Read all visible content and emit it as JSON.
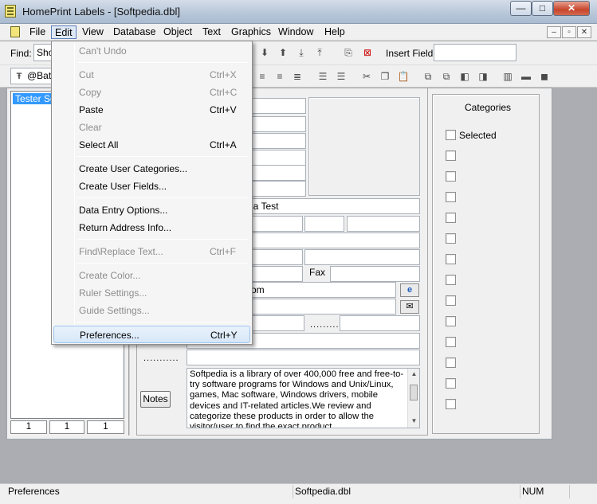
{
  "window": {
    "title": "HomePrint Labels - [Softpedia.dbl]",
    "min": "—",
    "max": "□",
    "close": "✕"
  },
  "menubar": [
    "File",
    "Edit",
    "View",
    "Database",
    "Object",
    "Text",
    "Graphics",
    "Window",
    "Help"
  ],
  "mdi_controls": [
    "–",
    "▫",
    "✕"
  ],
  "toolbar": {
    "find_label": "Find:",
    "find_value": "Sho",
    "insert_field_label": "Insert Field:",
    "insert_field_value": "",
    "font_value": "@Bata"
  },
  "records": {
    "selected": "Tester So",
    "counters": [
      "1",
      "1",
      "1"
    ]
  },
  "form": {
    "company": "ia Test",
    "fax_label": "Fax",
    "web": "om",
    "dots_1": "..........",
    "dots_2": "...........",
    "notes_button": "Notes",
    "notes_text": "Softpedia is a library of over 400,000 free and free-to-try software programs for Windows and Unix/Linux, games, Mac software, Windows drivers, mobile devices and IT-related articles.We review and categorize these products in order to allow the visitor/user to find the exact product"
  },
  "categories": {
    "title": "Categories",
    "first_label": "Selected",
    "count": 14
  },
  "edit_menu": [
    {
      "label": "Can't Undo",
      "shortcut": "",
      "disabled": true
    },
    {
      "sep": true
    },
    {
      "label": "Cut",
      "shortcut": "Ctrl+X",
      "disabled": true
    },
    {
      "label": "Copy",
      "shortcut": "Ctrl+C",
      "disabled": true
    },
    {
      "label": "Paste",
      "shortcut": "Ctrl+V",
      "disabled": false
    },
    {
      "label": "Clear",
      "shortcut": "",
      "disabled": true
    },
    {
      "label": "Select All",
      "shortcut": "Ctrl+A",
      "disabled": false
    },
    {
      "sep": true
    },
    {
      "label": "Create User Categories...",
      "shortcut": "",
      "disabled": false
    },
    {
      "label": "Create User Fields...",
      "shortcut": "",
      "disabled": false
    },
    {
      "sep": true
    },
    {
      "label": "Data Entry Options...",
      "shortcut": "",
      "disabled": false
    },
    {
      "label": "Return Address Info...",
      "shortcut": "",
      "disabled": false
    },
    {
      "sep": true
    },
    {
      "label": "Find\\Replace Text...",
      "shortcut": "Ctrl+F",
      "disabled": true
    },
    {
      "sep": true
    },
    {
      "label": "Create Color...",
      "shortcut": "",
      "disabled": true
    },
    {
      "label": "Ruler Settings...",
      "shortcut": "",
      "disabled": true
    },
    {
      "label": "Guide Settings...",
      "shortcut": "",
      "disabled": true
    },
    {
      "sep": true
    },
    {
      "label": "Preferences...",
      "shortcut": "Ctrl+Y",
      "disabled": false,
      "hover": true
    }
  ],
  "statusbar": {
    "message": "Preferences",
    "file": "Softpedia.dbl",
    "num": "NUM"
  }
}
